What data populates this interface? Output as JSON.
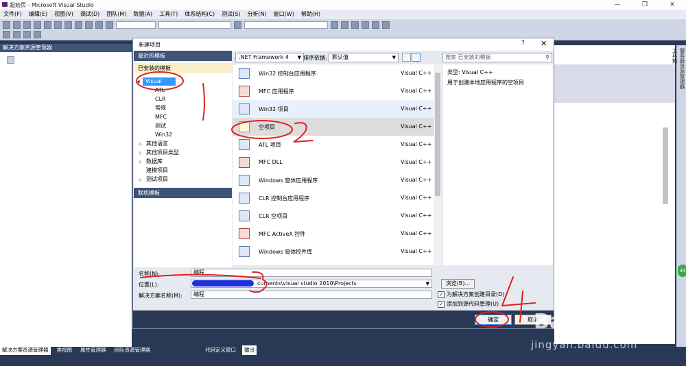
{
  "window": {
    "title": "起始页 - Microsoft Visual Studio",
    "min": "—",
    "restore": "❐",
    "close": "✕"
  },
  "menu": [
    "文件(F)",
    "编辑(E)",
    "视图(V)",
    "调试(D)",
    "团队(M)",
    "数据(A)",
    "工具(T)",
    "体系结构(C)",
    "测试(S)",
    "分析(N)",
    "窗口(W)",
    "帮助(H)"
  ],
  "left_pane": {
    "title": "解决方案资源管理器"
  },
  "bottom_tabs": [
    "解决方案资源管理器",
    "类视图",
    "属性管理器",
    "团队资源管理器"
  ],
  "bottom_tabs2": [
    "代码定义窗口",
    "输出"
  ],
  "right_vtabs": [
    "服务器资源管理器",
    "工具箱"
  ],
  "badge": "34",
  "dialog": {
    "title": "新建项目",
    "help": "?",
    "close": "✕",
    "nav": {
      "recent": "最近的模板",
      "installed": "已安装的模板",
      "selected": "Visual C++",
      "children": [
        "ATL",
        "CLR",
        "常规",
        "MFC",
        "测试",
        "Win32"
      ],
      "others": [
        {
          "label": "其他语言",
          "arrow": "▷"
        },
        {
          "label": "其他项目类型",
          "arrow": "▷"
        },
        {
          "label": "数据库",
          "arrow": "▷"
        },
        {
          "label": "建模项目",
          "arrow": ""
        },
        {
          "label": "测试项目",
          "arrow": "▷"
        }
      ],
      "online": "联机模板"
    },
    "framework": ".NET Framework 4",
    "sort_label": "排序依据:",
    "sort_value": "默认值",
    "search_placeholder": "搜索 已安装的模板",
    "templates": [
      {
        "name": "Win32 控制台应用程序",
        "lang": "Visual C++"
      },
      {
        "name": "MFC 应用程序",
        "lang": "Visual C++"
      },
      {
        "name": "Win32 项目",
        "lang": "Visual C++"
      },
      {
        "name": "空项目",
        "lang": "Visual C++"
      },
      {
        "name": "ATL 项目",
        "lang": "Visual C++"
      },
      {
        "name": "MFC DLL",
        "lang": "Visual C++"
      },
      {
        "name": "Windows 窗体应用程序",
        "lang": "Visual C++"
      },
      {
        "name": "CLR 控制台应用程序",
        "lang": "Visual C++"
      },
      {
        "name": "CLR 空项目",
        "lang": "Visual C++"
      },
      {
        "name": "MFC ActiveX 控件",
        "lang": "Visual C++"
      },
      {
        "name": "Windows 窗体控件库",
        "lang": "Visual C++"
      }
    ],
    "desc_type": "类型:  Visual C++",
    "desc_text": "用于创建本地应用程序的空项目",
    "name_label": "名称(N):",
    "name_value": "编程",
    "location_label": "位置(L):",
    "location_value": "cuments\\visual studio 2010\\Projects",
    "solution_label": "解决方案名称(M):",
    "solution_value": "编程",
    "browse": "浏览(B)...",
    "chk_dir": "为解决方案创建目录(D)",
    "chk_src": "添加到源代码管理(U)",
    "ok": "确定",
    "cancel": "取消"
  },
  "watermark": {
    "logo": "Bai",
    "brand": "经验",
    "url": "jingyan.baidu.com"
  },
  "annotations": [
    "1",
    "2",
    "3",
    "4"
  ]
}
